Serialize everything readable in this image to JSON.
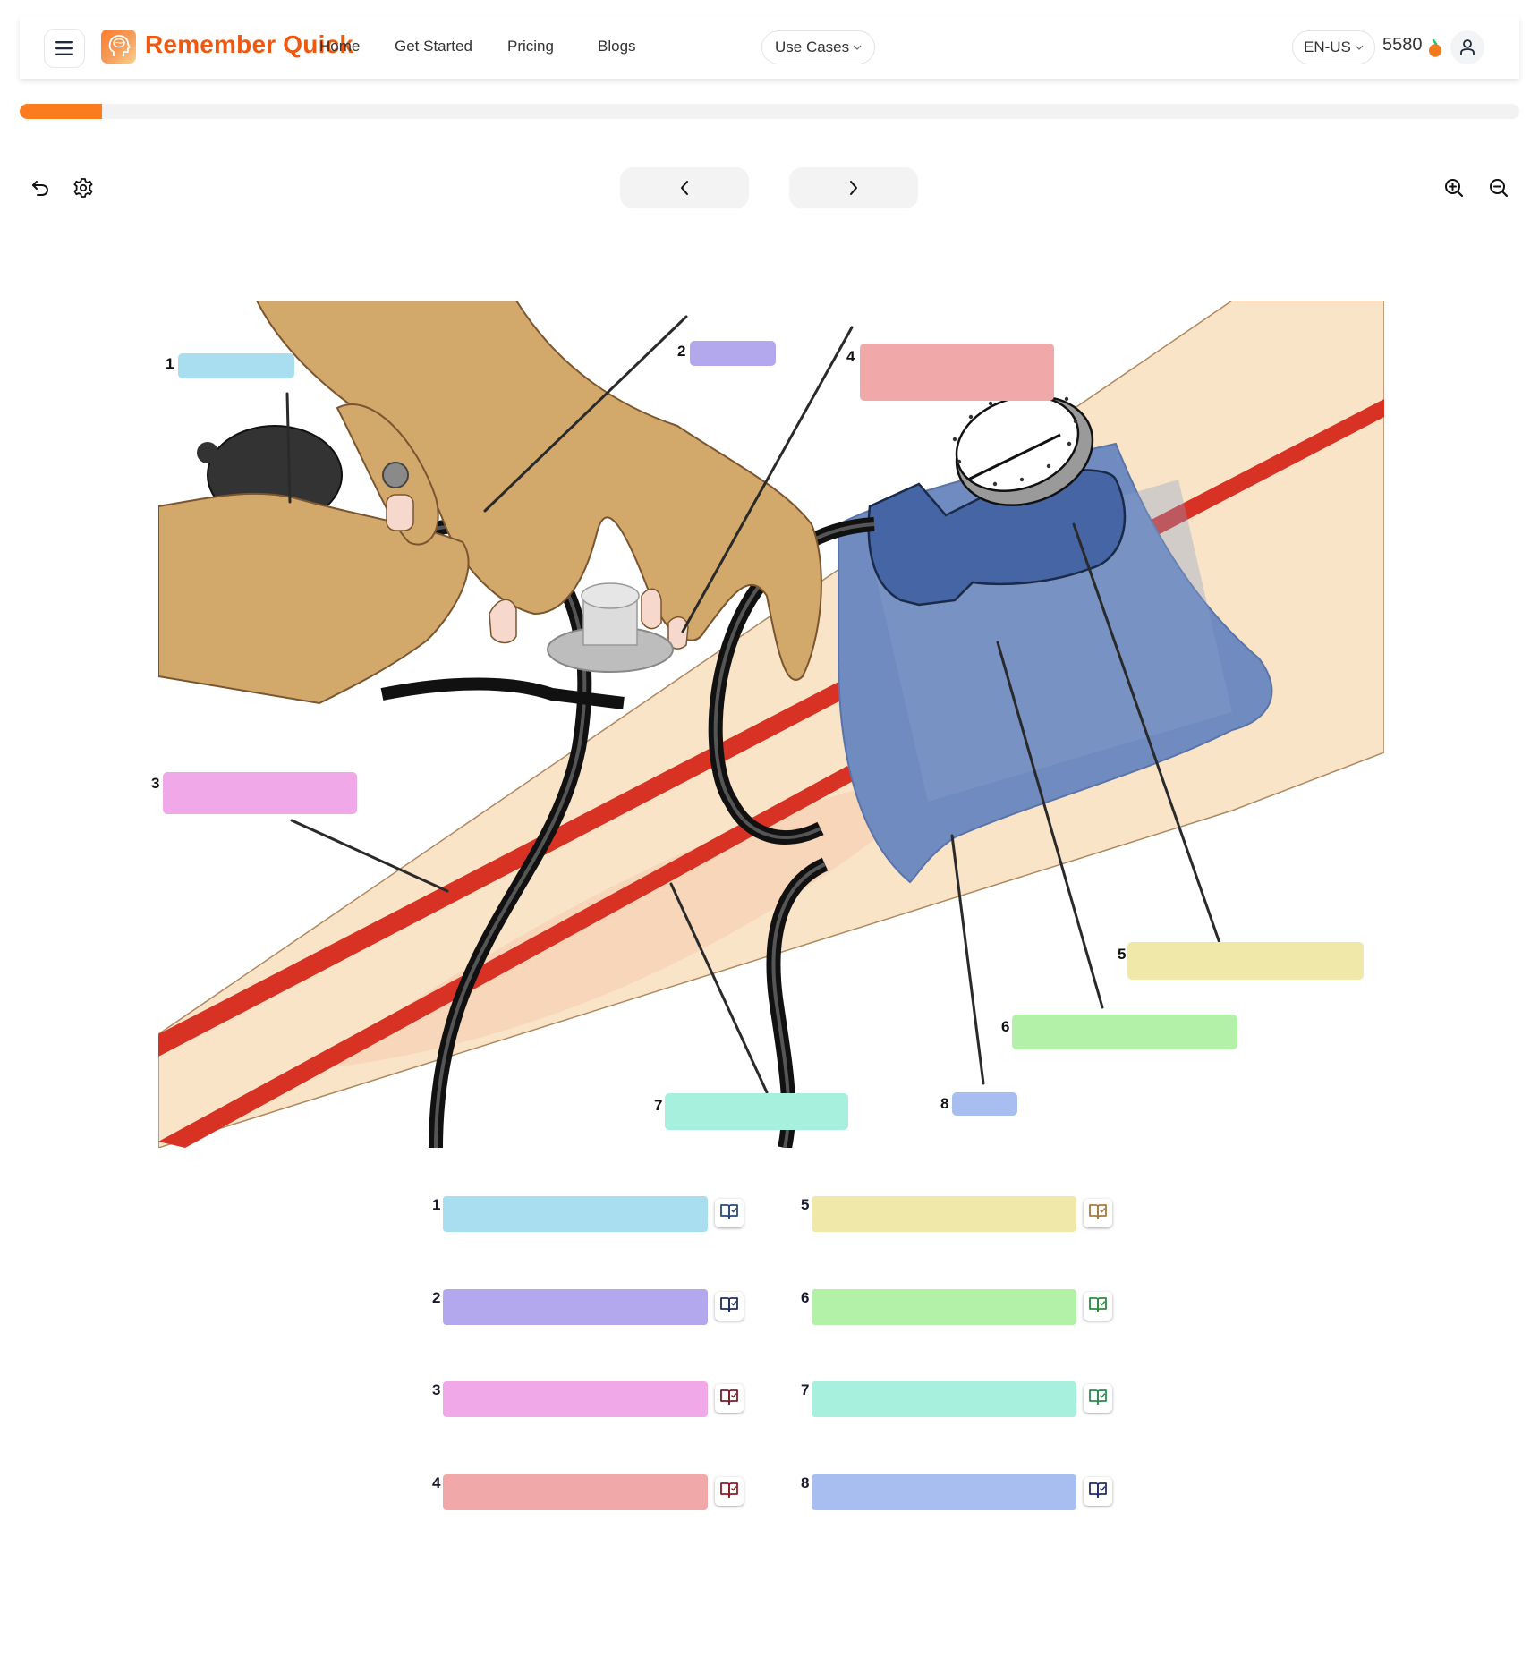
{
  "header": {
    "brand": "Remember Quick",
    "nav": [
      "Home",
      "Get Started",
      "Pricing",
      "Blogs"
    ],
    "use_cases_label": "Use Cases",
    "language": "EN-US",
    "credits": "5580",
    "icons": {
      "menu": "hamburger-icon",
      "logo": "brain-head-logo",
      "credits": "orange-fruit-icon",
      "profile": "user-icon"
    }
  },
  "progress": {
    "fraction": 0.055,
    "color": "#fb7b1f"
  },
  "toolbar": {
    "left_icons": [
      "undo-icon",
      "gear-icon"
    ],
    "prev_icon": "chevron-left-icon",
    "next_icon": "chevron-right-icon",
    "right_icons": [
      "zoom-in-icon",
      "zoom-out-icon"
    ]
  },
  "diagram": {
    "subject": "Blood pressure measurement with sphygmomanometer and stethoscope",
    "hotspots": [
      {
        "num": "1",
        "color": "#a8def0"
      },
      {
        "num": "2",
        "color": "#b3a8ee"
      },
      {
        "num": "3",
        "color": "#f0a8e8"
      },
      {
        "num": "4",
        "color": "#f0a8a8"
      },
      {
        "num": "5",
        "color": "#f0e8a8"
      },
      {
        "num": "6",
        "color": "#b3f0a8"
      },
      {
        "num": "7",
        "color": "#a8f0de"
      },
      {
        "num": "8",
        "color": "#a8bdf0"
      }
    ]
  },
  "answers": [
    {
      "num": "1",
      "color": "#a8def0",
      "value": "",
      "icon": "book-check-icon",
      "icon_color": "#2b4a7a"
    },
    {
      "num": "2",
      "color": "#b3a8ee",
      "value": "",
      "icon": "book-check-icon",
      "icon_color": "#1e2f5e"
    },
    {
      "num": "3",
      "color": "#f0a8e8",
      "value": "",
      "icon": "book-check-icon",
      "icon_color": "#7a1e2a"
    },
    {
      "num": "4",
      "color": "#f0a8a8",
      "value": "",
      "icon": "book-check-icon",
      "icon_color": "#8a1e24"
    },
    {
      "num": "5",
      "color": "#f0e8a8",
      "value": "",
      "icon": "book-check-icon",
      "icon_color": "#a67a3e"
    },
    {
      "num": "6",
      "color": "#b3f0a8",
      "value": "",
      "icon": "book-check-icon",
      "icon_color": "#2e8a3e"
    },
    {
      "num": "7",
      "color": "#a8f0de",
      "value": "",
      "icon": "book-check-icon",
      "icon_color": "#2e8a4e"
    },
    {
      "num": "8",
      "color": "#a8bdf0",
      "value": "",
      "icon": "book-check-icon",
      "icon_color": "#1e2f6e"
    }
  ]
}
